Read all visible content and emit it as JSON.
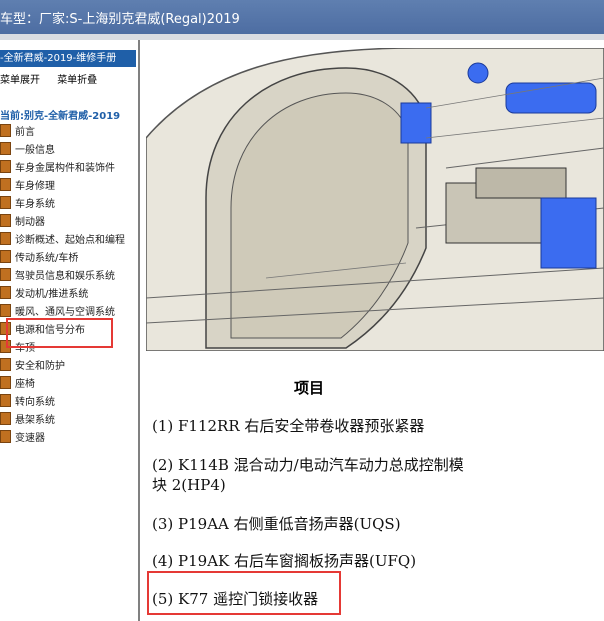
{
  "window": {
    "title": "车型：厂家:S-上海别克君威(Regal)2019"
  },
  "sidebar": {
    "header": "-全新君威-2019-维修手册",
    "tools": [
      "菜单展开",
      "菜单折叠"
    ],
    "current": "当前:别克-全新君威-2019",
    "items": [
      "前言",
      "一般信息",
      "车身金属构件和装饰件",
      "车身修理",
      "车身系统",
      "制动器",
      "诊断概述、起始点和编程",
      "传动系统/车桥",
      "驾驶员信息和娱乐系统",
      "发动机/推进系统",
      "暖风、通风与空调系统",
      "电源和信号分布",
      "车顶",
      "安全和防护",
      "座椅",
      "转向系统",
      "悬架系统",
      "变速器"
    ]
  },
  "content": {
    "section_title": "项目",
    "items": [
      "(1) F112RR 右后安全带卷收器预张紧器",
      "(2) K114B 混合动力/电动汽车动力总成控制模块 2(HP4)",
      "(3) P19AA 右侧重低音扬声器(UQS)",
      "(4) P19AK 右后车窗搁板扬声器(UFQ)",
      "(5) K77 遥控门锁接收器"
    ]
  },
  "colors": {
    "title_bar": "#4a6aa0",
    "sidebar_header": "#1f5fa8",
    "highlight_box": "#e53935",
    "part_highlight": "#3b6cf0"
  }
}
